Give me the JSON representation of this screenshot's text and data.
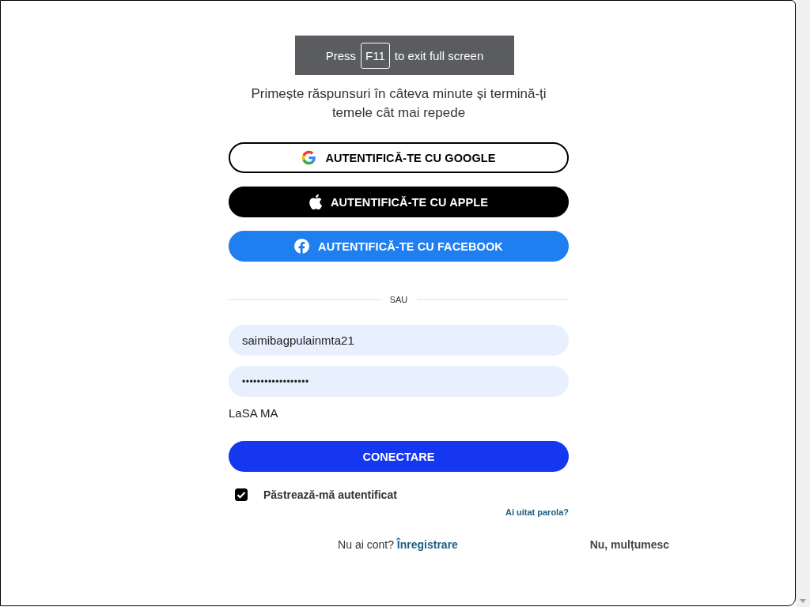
{
  "overlay": {
    "prefix": "Press",
    "key": "F11",
    "suffix": "to exit full screen"
  },
  "subtitle": "Primește răspunsuri în câteva minute și termină-ți temele cât mai repede",
  "social_buttons": [
    {
      "kind": "google",
      "label": "AUTENTIFICĂ-TE CU GOOGLE"
    },
    {
      "kind": "apple",
      "label": "AUTENTIFICĂ-TE CU APPLE"
    },
    {
      "kind": "facebook",
      "label": "AUTENTIFICĂ-TE CU FACEBOOK"
    }
  ],
  "divider": "SAU",
  "username": {
    "value": "saimibagpulainmta21"
  },
  "password": {
    "value": "••••••••••••••••••"
  },
  "note": "LaSA MA",
  "submit": "CONECTARE",
  "remember": {
    "label": "Păstrează-mă autentificat",
    "checked": true
  },
  "forgot": "Ai uitat parola?",
  "signup": {
    "prompt": "Nu ai cont?",
    "link": "Înregistrare"
  },
  "dismiss": "Nu, mulțumesc"
}
